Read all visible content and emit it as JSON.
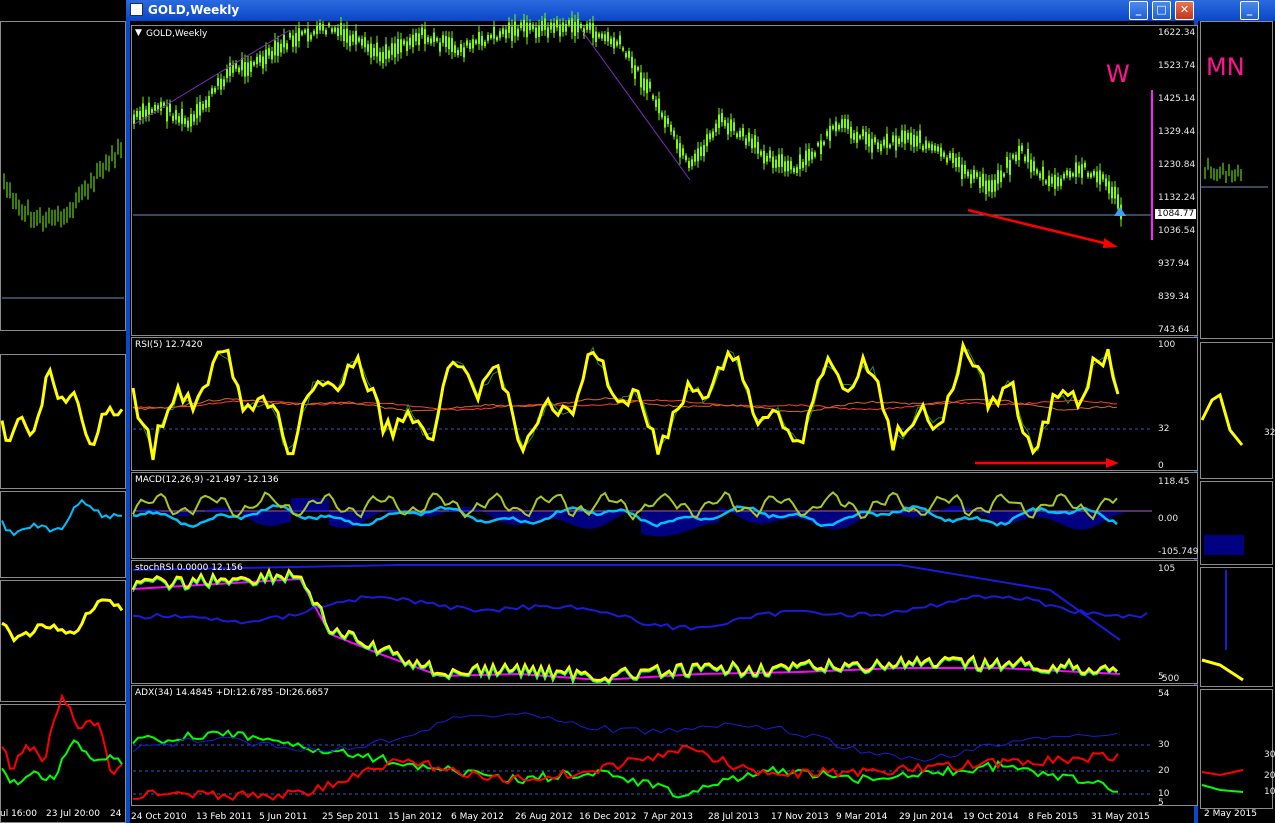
{
  "window": {
    "title": "GOLD,Weekly",
    "minimize_glyph": "_",
    "maximize_glyph": "□",
    "close_glyph": "✕"
  },
  "main_chart": {
    "label": "GOLD,Weekly",
    "timeframe_mark": "W",
    "price_axis": [
      "1622.34",
      "1523.74",
      "1425.14",
      "1329.44",
      "1230.84",
      "1132.24",
      "1036.54",
      "937.94",
      "839.34",
      "743.64"
    ],
    "current_price": "1084.77"
  },
  "right_window": {
    "timeframe_mark": "MN",
    "rsi_level": "32",
    "adx_levels": [
      "30",
      "20",
      "10"
    ],
    "date_fragment": "2 May 2015"
  },
  "left_window": {
    "dates": [
      "ul 16:00",
      "23 Jul 20:00",
      "24"
    ]
  },
  "rsi": {
    "label": "RSI(5) 12.7420",
    "axis": [
      "100",
      "32",
      "0"
    ]
  },
  "macd": {
    "label": "MACD(12,26,9) -21.497 -12.136",
    "axis": [
      "118.45",
      "0.00",
      "-105.749"
    ]
  },
  "stoch": {
    "label": "stochRSI 0.0000 12.156",
    "axis": [
      "105",
      "5",
      "500"
    ]
  },
  "adx": {
    "label": "ADX(34) 14.4845 +DI:12.6785 -DI:26.6657",
    "axis": [
      "54",
      "30",
      "20",
      "10",
      "5"
    ]
  },
  "dates": [
    "24 Oct 2010",
    "13 Feb 2011",
    "5 Jun 2011",
    "25 Sep 2011",
    "15 Jan 2012",
    "6 May 2012",
    "26 Aug 2012",
    "16 Dec 2012",
    "7 Apr 2013",
    "28 Jul 2013",
    "17 Nov 2013",
    "9 Mar 2014",
    "29 Jun 2014",
    "19 Oct 2014",
    "8 Feb 2015",
    "31 May 2015"
  ],
  "colors": {
    "candle": "#7CFC00",
    "rsi": "#FFFF00",
    "timeframe_mark": "#FF1493",
    "arrow": "#FF0000",
    "title_bar": "#0A46C8",
    "macd_hist": "#0000FF",
    "adx_plus": "#00FF00",
    "adx_minus": "#FF0000"
  }
}
